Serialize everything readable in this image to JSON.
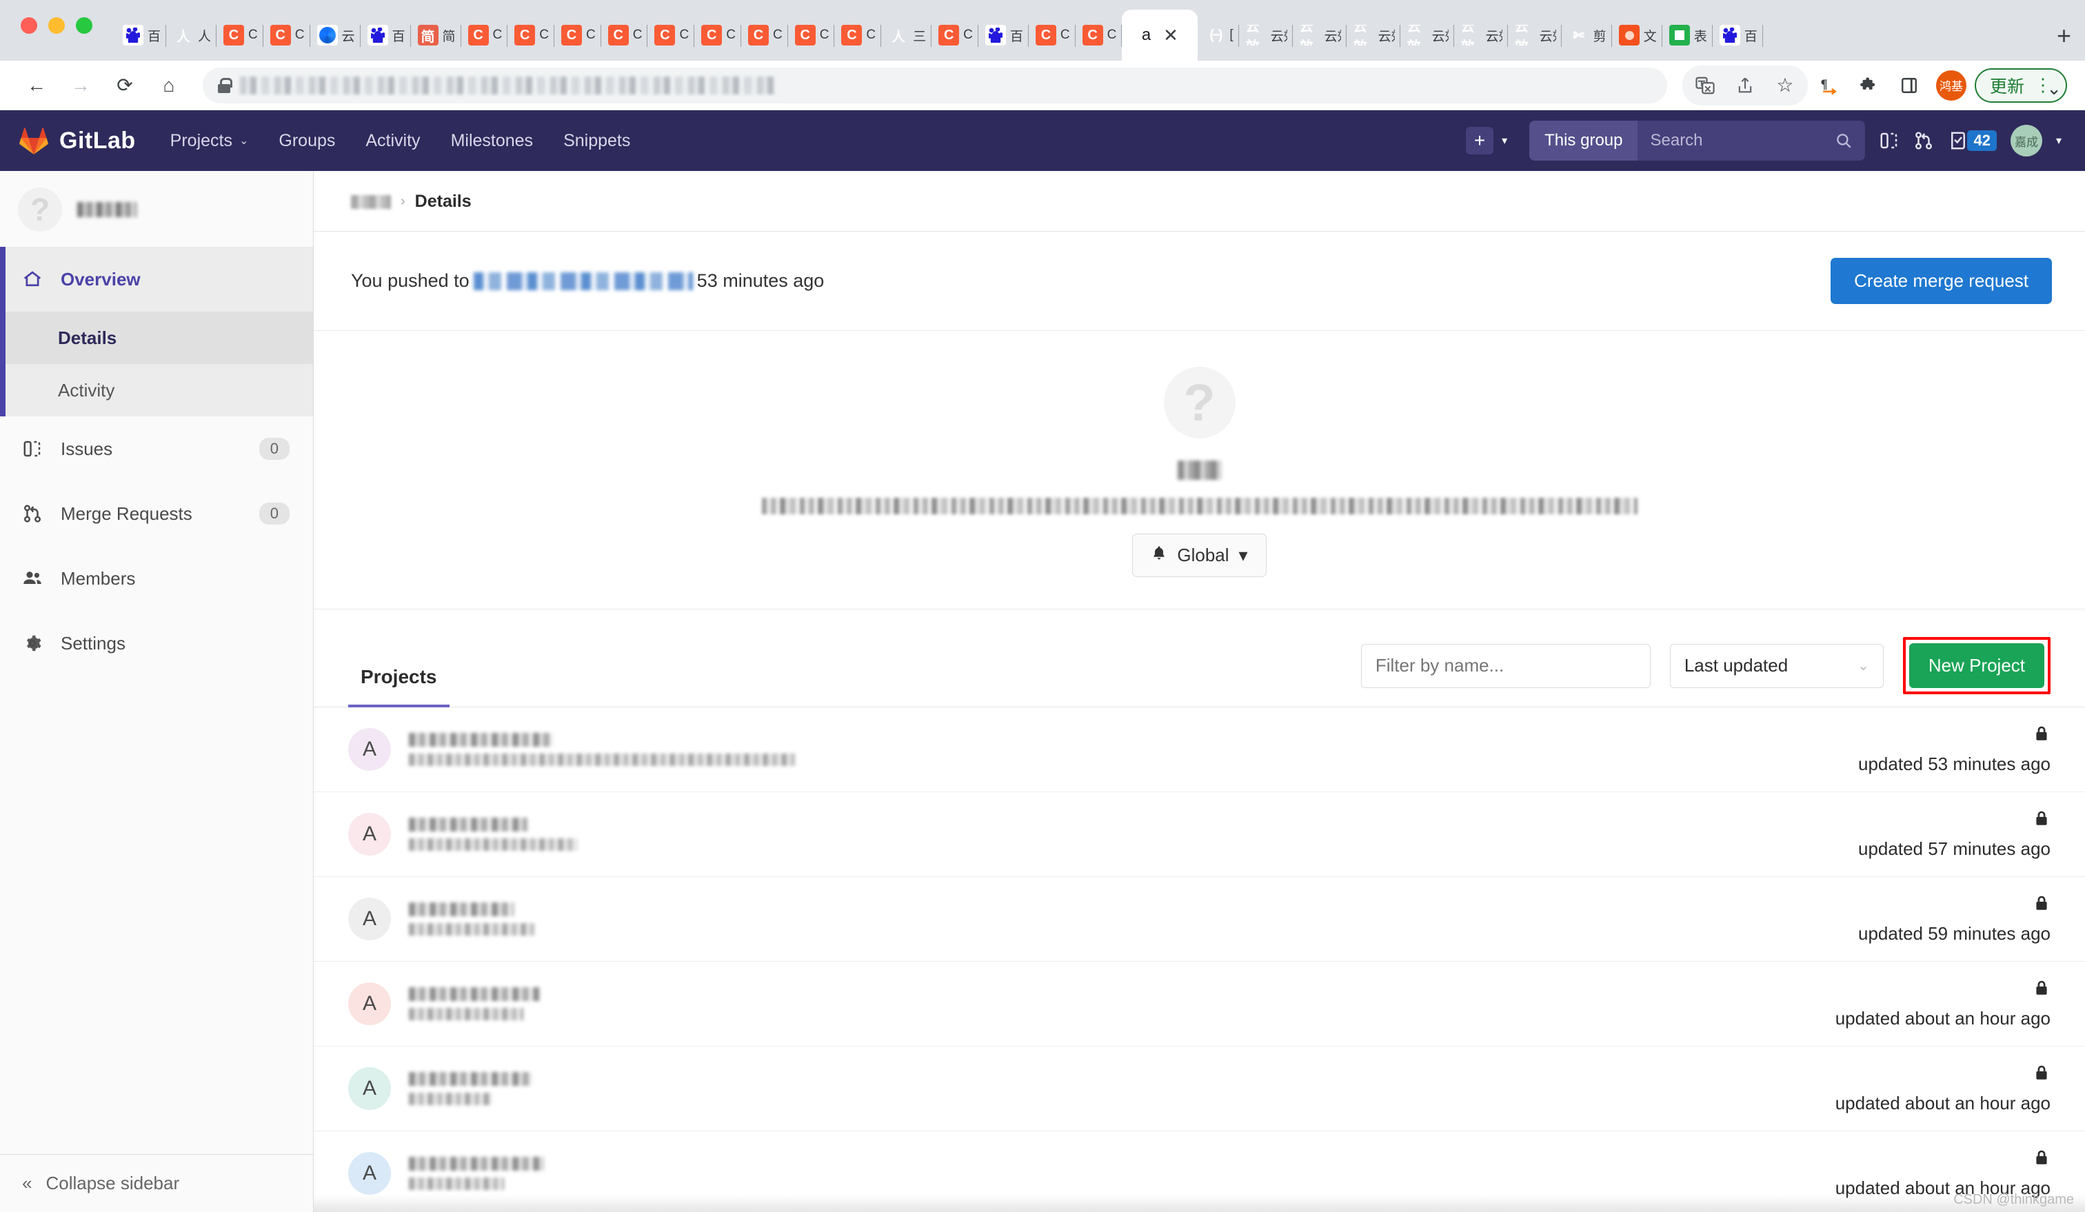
{
  "browser": {
    "window_controls": [
      "close",
      "minimize",
      "maximize"
    ],
    "tabs": [
      {
        "icon": "baidu-icon",
        "title": "百",
        "kind": "baidu"
      },
      {
        "icon": "person-icon",
        "title": "人",
        "kind": "person"
      },
      {
        "icon": "csdn-icon",
        "title": "C",
        "kind": "c"
      },
      {
        "icon": "csdn-icon",
        "title": "C",
        "kind": "c"
      },
      {
        "icon": "browser-icon",
        "title": "云",
        "kind": "blue"
      },
      {
        "icon": "baidu-icon",
        "title": "百",
        "kind": "baidu"
      },
      {
        "icon": "jianshu-icon",
        "title": "简",
        "kind": "jian"
      },
      {
        "icon": "csdn-icon",
        "title": "C",
        "kind": "c"
      },
      {
        "icon": "csdn-icon",
        "title": "C",
        "kind": "c"
      },
      {
        "icon": "csdn-icon",
        "title": "C",
        "kind": "c"
      },
      {
        "icon": "csdn-icon",
        "title": "C",
        "kind": "c"
      },
      {
        "icon": "csdn-icon",
        "title": "C",
        "kind": "c"
      },
      {
        "icon": "csdn-icon",
        "title": "C",
        "kind": "c"
      },
      {
        "icon": "csdn-icon",
        "title": "C",
        "kind": "c"
      },
      {
        "icon": "csdn-icon",
        "title": "C",
        "kind": "c"
      },
      {
        "icon": "csdn-icon",
        "title": "C",
        "kind": "c"
      },
      {
        "icon": "person-icon",
        "title": "三",
        "kind": "person"
      },
      {
        "icon": "csdn-icon",
        "title": "C",
        "kind": "c"
      },
      {
        "icon": "baidu-icon",
        "title": "百",
        "kind": "baidu"
      },
      {
        "icon": "csdn-icon",
        "title": "C",
        "kind": "c"
      },
      {
        "icon": "csdn-icon",
        "title": "C",
        "kind": "c"
      }
    ],
    "active_tab": {
      "title": "a",
      "close_label": "✕"
    },
    "tabs_after": [
      {
        "icon": "gitlab-icon",
        "title": "[",
        "kind": "orange-br"
      },
      {
        "icon": "yunxiao-icon",
        "title": "云效",
        "kind": "yun"
      },
      {
        "icon": "yunxiao-icon",
        "title": "云效",
        "kind": "yun"
      },
      {
        "icon": "yunxiao-icon",
        "title": "云效",
        "kind": "yun"
      },
      {
        "icon": "yunxiao-icon",
        "title": "云效",
        "kind": "yun"
      },
      {
        "icon": "yunxiao-icon",
        "title": "云效",
        "kind": "yun"
      },
      {
        "icon": "yunxiao-icon",
        "title": "云效",
        "kind": "yun"
      },
      {
        "icon": "scissors-icon",
        "title": "剪",
        "kind": "x"
      },
      {
        "icon": "slides-icon",
        "title": "文",
        "kind": "ppt"
      },
      {
        "icon": "sheets-icon",
        "title": "表",
        "kind": "sheet"
      },
      {
        "icon": "baidu-icon",
        "title": "百",
        "kind": "baidu"
      }
    ],
    "new_tab_label": "+",
    "tab_list_chevron": "⌄",
    "toolbar": {
      "back": "←",
      "forward": "→",
      "reload": "⟳",
      "home": "⌂",
      "url_value": "",
      "url_placeholder": "",
      "translate": "translate-icon",
      "share": "share-icon",
      "bookmark": "☆",
      "reader": "¶",
      "extensions": "puzzle-icon",
      "sidepanel": "panel-icon",
      "profile_initials": "鸿基",
      "update_label": "更新",
      "menu": "⋮"
    }
  },
  "gitlab": {
    "brand": "GitLab",
    "nav_links": [
      {
        "label": "Projects",
        "has_caret": true
      },
      {
        "label": "Groups",
        "has_caret": false
      },
      {
        "label": "Activity",
        "has_caret": false
      },
      {
        "label": "Milestones",
        "has_caret": false
      },
      {
        "label": "Snippets",
        "has_caret": false
      }
    ],
    "nav_right": {
      "create_new": "+",
      "scope_label": "This group",
      "search_placeholder": "Search",
      "search_value": "",
      "issues_icon": "issues-icon",
      "merge_requests_icon": "merge-request-icon",
      "todos_icon": "todo-icon",
      "todos_count": "42",
      "user_initials": "嘉成"
    },
    "sidebar": {
      "group_name": "",
      "group_avatar_letter": "?",
      "items": [
        {
          "label": "Overview",
          "icon": "home-icon",
          "count": ""
        },
        {
          "label": "Details",
          "icon": "",
          "count": ""
        },
        {
          "label": "Activity",
          "icon": "",
          "count": ""
        },
        {
          "label": "Issues",
          "icon": "issues-icon",
          "count": "0"
        },
        {
          "label": "Merge Requests",
          "icon": "merge-request-icon",
          "count": "0"
        },
        {
          "label": "Members",
          "icon": "members-icon",
          "count": ""
        },
        {
          "label": "Settings",
          "icon": "gear-icon",
          "count": ""
        }
      ],
      "collapse_label": "Collapse sidebar",
      "collapse_icon": "«"
    },
    "breadcrumb": {
      "group": "",
      "separator": "›",
      "current": "Details"
    },
    "push_event": {
      "prefix": "You pushed to",
      "branch": "",
      "suffix": "53 minutes ago",
      "cta_label": "Create merge request"
    },
    "group_hero": {
      "avatar_letter": "?",
      "title": "",
      "description": "",
      "notification_icon": "bell-icon",
      "notification_label": "Global",
      "notification_caret": "▾"
    },
    "projects_panel": {
      "tab_label": "Projects",
      "filter_placeholder": "Filter by name...",
      "filter_value": "",
      "sort_value": "Last updated",
      "sort_caret": "⌄",
      "new_project_label": "New Project",
      "new_project_highlight_color": "#ff0000",
      "new_project_color": "#1aa457",
      "rows": [
        {
          "avatar_letter": "A",
          "avatar_color": "#f3e7f5",
          "name": "",
          "path": "",
          "visibility_icon": "lock-icon",
          "updated": "updated 53 minutes ago",
          "name_w": 210,
          "path_w": 560
        },
        {
          "avatar_letter": "A",
          "avatar_color": "#fae8ec",
          "name": "",
          "path": "",
          "visibility_icon": "lock-icon",
          "updated": "updated 57 minutes ago",
          "name_w": 172,
          "path_w": 244
        },
        {
          "avatar_letter": "A",
          "avatar_color": "#eeeeee",
          "name": "",
          "path": "",
          "visibility_icon": "lock-icon",
          "updated": "updated 59 minutes ago",
          "name_w": 152,
          "path_w": 182
        },
        {
          "avatar_letter": "A",
          "avatar_color": "#fae3e0",
          "name": "",
          "path": "",
          "visibility_icon": "lock-icon",
          "updated": "updated about an hour ago",
          "name_w": 190,
          "path_w": 166
        },
        {
          "avatar_letter": "A",
          "avatar_color": "#dcf0ec",
          "name": "",
          "path": "",
          "visibility_icon": "lock-icon",
          "updated": "updated about an hour ago",
          "name_w": 180,
          "path_w": 120
        },
        {
          "avatar_letter": "A",
          "avatar_color": "#d9e9f7",
          "name": "",
          "path": "",
          "visibility_icon": "lock-icon",
          "updated": "updated about an hour ago",
          "name_w": 196,
          "path_w": 138
        }
      ]
    },
    "watermark": "CSDN @thinkgame",
    "colors": {
      "navbar": "#2e2a5b",
      "accent": "#6b62c4",
      "primary_button": "#1f78d1",
      "success_button": "#1aa457",
      "todo_badge": "#1f75cb"
    }
  }
}
